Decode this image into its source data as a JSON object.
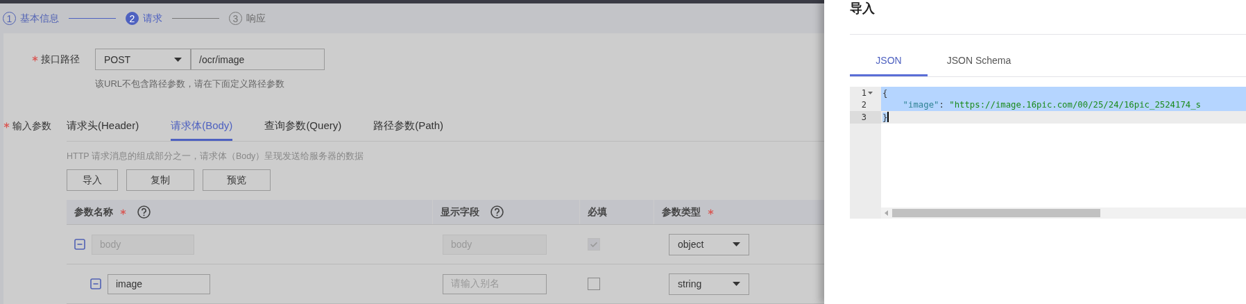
{
  "steps": [
    {
      "number": "1",
      "label": "基本信息",
      "done": true,
      "selected": false
    },
    {
      "number": "2",
      "label": "请求",
      "done": false,
      "selected": true
    },
    {
      "number": "3",
      "label": "响应",
      "done": false,
      "selected": false
    }
  ],
  "path": {
    "label": "接口路径",
    "required": true,
    "method": "POST",
    "value": "/ocr/image",
    "hint": "该URL不包含路径参数，请在下面定义路径参数"
  },
  "params": {
    "label": "输入参数",
    "required": true,
    "tabs": [
      {
        "label": "请求头(Header)",
        "selected": false
      },
      {
        "label": "请求体(Body)",
        "selected": true
      },
      {
        "label": "查询参数(Query)",
        "selected": false
      },
      {
        "label": "路径参数(Path)",
        "selected": false
      }
    ],
    "description": "HTTP 请求消息的组成部分之一，请求体（Body）呈现发送给服务器的数据",
    "buttons": [
      "导入",
      "复制",
      "预览"
    ],
    "table": {
      "columns": [
        {
          "label": "参数名称",
          "required": true,
          "help": true
        },
        {
          "label": "显示字段",
          "required": false,
          "help": true
        },
        {
          "label": "必填",
          "required": false,
          "help": false
        },
        {
          "label": "参数类型",
          "required": true,
          "help": false
        }
      ],
      "rows": [
        {
          "name": "body",
          "display": "body",
          "disabled": true,
          "checked": true,
          "type": "object",
          "children": [
            {
              "name": "image",
              "display_placeholder": "请输入别名",
              "disabled": false,
              "checked": false,
              "type": "string"
            }
          ]
        }
      ]
    }
  },
  "drawer": {
    "title": "导入",
    "tabs": [
      {
        "label": "JSON",
        "selected": true
      },
      {
        "label": "JSON Schema",
        "selected": false
      }
    ],
    "editor": {
      "lines": [
        {
          "number": "1",
          "foldable": true,
          "selected": true,
          "active": false,
          "cursor": false,
          "tokens": [
            {
              "kind": "punct",
              "text": "{"
            }
          ]
        },
        {
          "number": "2",
          "foldable": false,
          "selected": true,
          "active": false,
          "cursor": false,
          "tokens": [
            {
              "kind": "key",
              "text": "    \"image\""
            },
            {
              "kind": "punct",
              "text": ": "
            },
            {
              "kind": "string",
              "text": "\"https://image.16pic.com/00/25/24/16pic_2524174_s"
            }
          ]
        },
        {
          "number": "3",
          "foldable": false,
          "selected": true,
          "active": true,
          "cursor": true,
          "tokens": [
            {
              "kind": "punct",
              "text": "}"
            }
          ]
        }
      ]
    }
  }
}
